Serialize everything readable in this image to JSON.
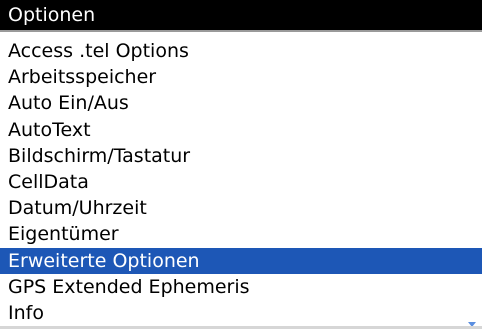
{
  "title_bar": {
    "title": "Optionen"
  },
  "menu": {
    "items": [
      {
        "label": "Access .tel Options"
      },
      {
        "label": "Arbeitsspeicher"
      },
      {
        "label": "Auto Ein/Aus"
      },
      {
        "label": "AutoText"
      },
      {
        "label": "Bildschirm/Tastatur"
      },
      {
        "label": "CellData"
      },
      {
        "label": "Datum/Uhrzeit"
      },
      {
        "label": "Eigentümer"
      },
      {
        "label": "Erweiterte Optionen"
      },
      {
        "label": "GPS Extended Ephemeris"
      },
      {
        "label": "Info"
      }
    ],
    "selected_label": "Erweiterte Optionen"
  },
  "icons": {
    "scroll_down": "chevron-down-icon"
  },
  "colors": {
    "title_bg": "#000000",
    "title_text": "#ffffff",
    "selection_bg": "#1d57b6",
    "selection_text": "#ffffff",
    "list_bg": "#ffffff",
    "scroll_indicator": "#5a8ee0"
  }
}
